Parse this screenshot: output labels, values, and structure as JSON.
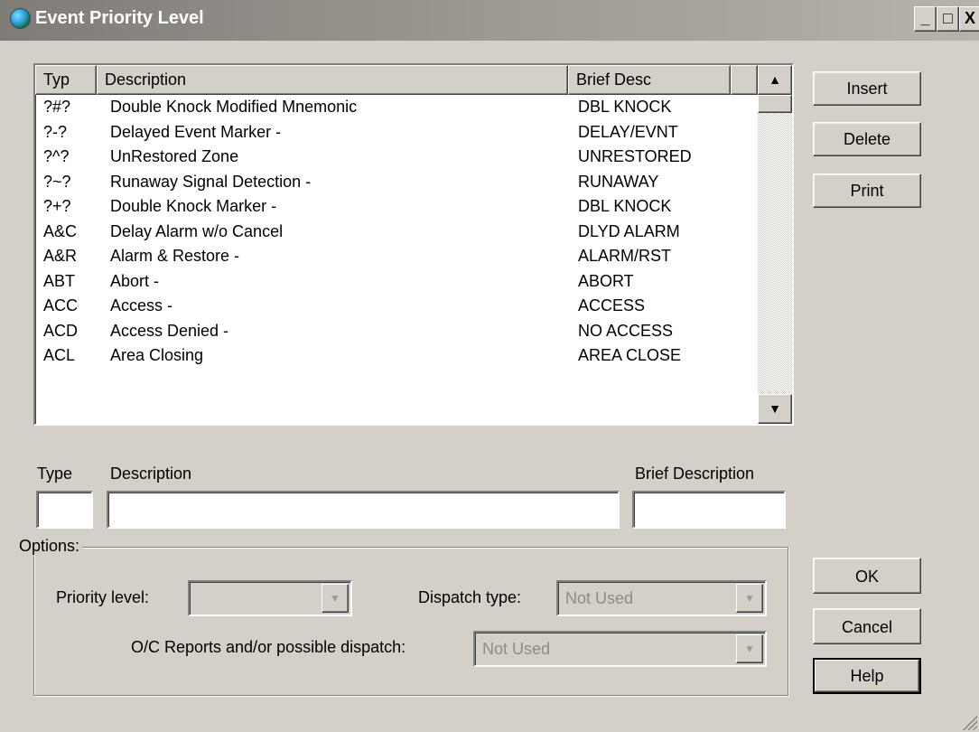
{
  "window": {
    "title": "Event Priority Level",
    "controls": {
      "minimize": "_",
      "maximize": "□",
      "close": "X"
    }
  },
  "list": {
    "columns": [
      "Typ",
      "Description",
      "Brief Desc"
    ],
    "rows": [
      {
        "type": "?#?",
        "description": "Double Knock Modified Mnemonic",
        "brief": "DBL KNOCK"
      },
      {
        "type": "?-?",
        "description": "Delayed Event Marker -",
        "brief": "DELAY/EVNT"
      },
      {
        "type": "?^?",
        "description": "UnRestored Zone",
        "brief": "UNRESTORED"
      },
      {
        "type": "?~?",
        "description": "Runaway Signal Detection -",
        "brief": "RUNAWAY"
      },
      {
        "type": "?+?",
        "description": "Double Knock Marker -",
        "brief": "DBL KNOCK"
      },
      {
        "type": "A&C",
        "description": "Delay Alarm w/o Cancel",
        "brief": "DLYD ALARM"
      },
      {
        "type": "A&R",
        "description": "Alarm & Restore -",
        "brief": "ALARM/RST"
      },
      {
        "type": "ABT",
        "description": "Abort -",
        "brief": "ABORT"
      },
      {
        "type": "ACC",
        "description": "Access -",
        "brief": "ACCESS"
      },
      {
        "type": "ACD",
        "description": "Access Denied -",
        "brief": "NO ACCESS"
      },
      {
        "type": "ACL",
        "description": "Area Closing",
        "brief": "AREA CLOSE"
      }
    ],
    "scroll_up_icon": "triangle-up",
    "scroll_down_icon": "triangle-down"
  },
  "side_buttons": {
    "insert": "Insert",
    "delete": "Delete",
    "print": "Print"
  },
  "form": {
    "type_label": "Type",
    "description_label": "Description",
    "brief_label": "Brief Description",
    "type_value": "",
    "description_value": "",
    "brief_value": ""
  },
  "options": {
    "legend": "Options:",
    "priority_label": "Priority level:",
    "priority_value": "",
    "dispatch_type_label": "Dispatch type:",
    "dispatch_type_value": "Not Used",
    "oc_label": "O/C Reports and/or possible dispatch:",
    "oc_value": "Not Used"
  },
  "dialog_buttons": {
    "ok": "OK",
    "cancel": "Cancel",
    "help": "Help"
  }
}
